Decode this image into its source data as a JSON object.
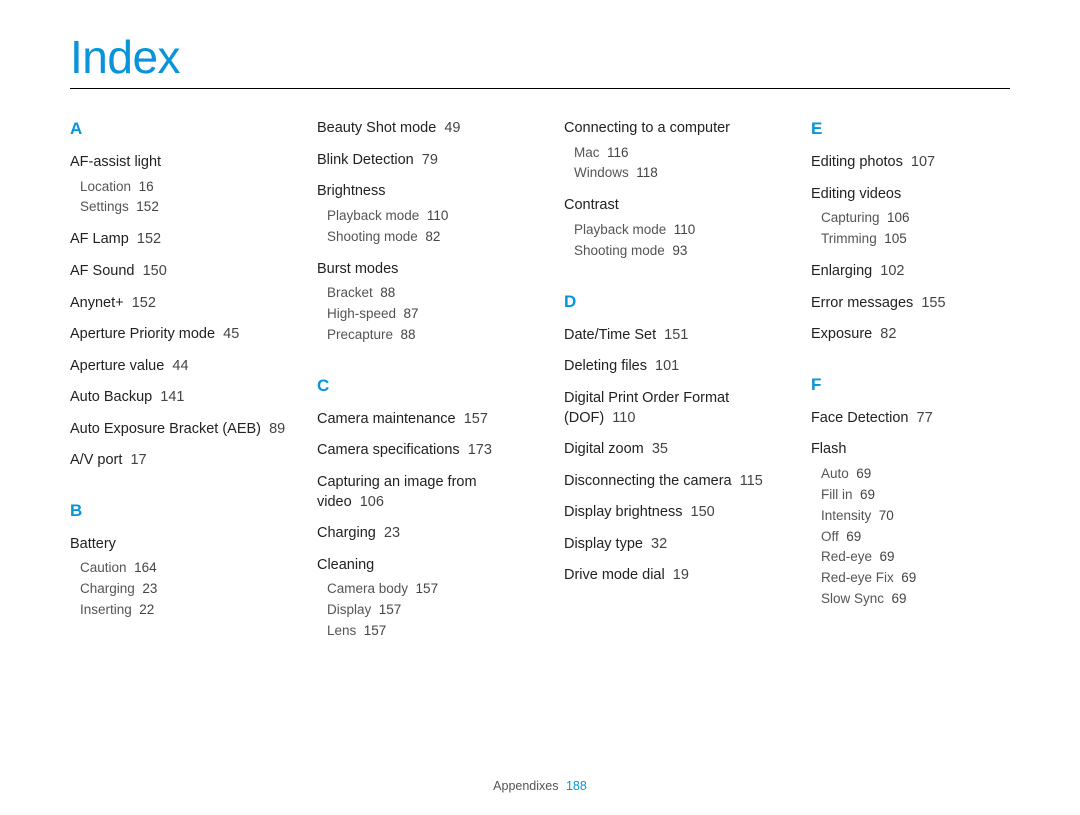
{
  "title": "Index",
  "footer": {
    "label": "Appendixes",
    "page": "188"
  },
  "sections": [
    {
      "letter": "A",
      "entries": [
        {
          "label": "AF-assist light",
          "subs": [
            {
              "label": "Location",
              "page": "16"
            },
            {
              "label": "Settings",
              "page": "152"
            }
          ]
        },
        {
          "label": "AF Lamp",
          "page": "152"
        },
        {
          "label": "AF Sound",
          "page": "150"
        },
        {
          "label": "Anynet+",
          "page": "152"
        },
        {
          "label": "Aperture Priority mode",
          "page": "45"
        },
        {
          "label": "Aperture value",
          "page": "44"
        },
        {
          "label": "Auto Backup",
          "page": "141"
        },
        {
          "label": "Auto Exposure Bracket (AEB)",
          "page": "89"
        },
        {
          "label": "A/V port",
          "page": "17"
        }
      ]
    },
    {
      "letter": "B",
      "entries": [
        {
          "label": "Battery",
          "subs": [
            {
              "label": "Caution",
              "page": "164"
            },
            {
              "label": "Charging",
              "page": "23"
            },
            {
              "label": "Inserting",
              "page": "22"
            }
          ]
        }
      ]
    },
    {
      "letter": "_col2top",
      "entries": [
        {
          "label": "Beauty Shot mode",
          "page": "49"
        },
        {
          "label": "Blink Detection",
          "page": "79"
        },
        {
          "label": "Brightness",
          "subs": [
            {
              "label": "Playback mode",
              "page": "110"
            },
            {
              "label": "Shooting mode",
              "page": "82"
            }
          ]
        },
        {
          "label": "Burst modes",
          "subs": [
            {
              "label": "Bracket",
              "page": "88"
            },
            {
              "label": "High-speed",
              "page": "87"
            },
            {
              "label": "Precapture",
              "page": "88"
            }
          ]
        }
      ]
    },
    {
      "letter": "C",
      "entries": [
        {
          "label": "Camera maintenance",
          "page": "157"
        },
        {
          "label": "Camera specifications",
          "page": "173"
        },
        {
          "label": "Capturing an image from video",
          "page": "106"
        },
        {
          "label": "Charging",
          "page": "23"
        },
        {
          "label": "Cleaning",
          "subs": [
            {
              "label": "Camera body",
              "page": "157"
            },
            {
              "label": "Display",
              "page": "157"
            },
            {
              "label": "Lens",
              "page": "157"
            }
          ]
        }
      ]
    },
    {
      "letter": "_col3top",
      "entries": [
        {
          "label": "Connecting to a computer",
          "subs": [
            {
              "label": "Mac",
              "page": "116"
            },
            {
              "label": "Windows",
              "page": "118"
            }
          ]
        },
        {
          "label": "Contrast",
          "subs": [
            {
              "label": "Playback mode",
              "page": "110"
            },
            {
              "label": "Shooting mode",
              "page": "93"
            }
          ]
        }
      ]
    },
    {
      "letter": "D",
      "entries": [
        {
          "label": "Date/Time Set",
          "page": "151"
        },
        {
          "label": "Deleting files",
          "page": "101"
        },
        {
          "label": "Digital Print Order Format (DOF)",
          "page": "110"
        },
        {
          "label": "Digital zoom",
          "page": "35"
        },
        {
          "label": "Disconnecting the camera",
          "page": "115"
        },
        {
          "label": "Display brightness",
          "page": "150"
        },
        {
          "label": "Display type",
          "page": "32"
        },
        {
          "label": "Drive mode dial",
          "page": "19"
        }
      ]
    },
    {
      "letter": "E",
      "entries": [
        {
          "label": "Editing photos",
          "page": "107"
        },
        {
          "label": "Editing videos",
          "subs": [
            {
              "label": "Capturing",
              "page": "106"
            },
            {
              "label": "Trimming",
              "page": "105"
            }
          ]
        },
        {
          "label": "Enlarging",
          "page": "102"
        },
        {
          "label": "Error messages",
          "page": "155"
        },
        {
          "label": "Exposure",
          "page": "82"
        }
      ]
    },
    {
      "letter": "F",
      "entries": [
        {
          "label": "Face Detection",
          "page": "77"
        },
        {
          "label": "Flash",
          "subs": [
            {
              "label": "Auto",
              "page": "69"
            },
            {
              "label": "Fill in",
              "page": "69"
            },
            {
              "label": "Intensity",
              "page": "70"
            },
            {
              "label": "Off",
              "page": "69"
            },
            {
              "label": "Red-eye",
              "page": "69"
            },
            {
              "label": "Red-eye Fix",
              "page": "69"
            },
            {
              "label": "Slow Sync",
              "page": "69"
            }
          ]
        }
      ]
    }
  ]
}
